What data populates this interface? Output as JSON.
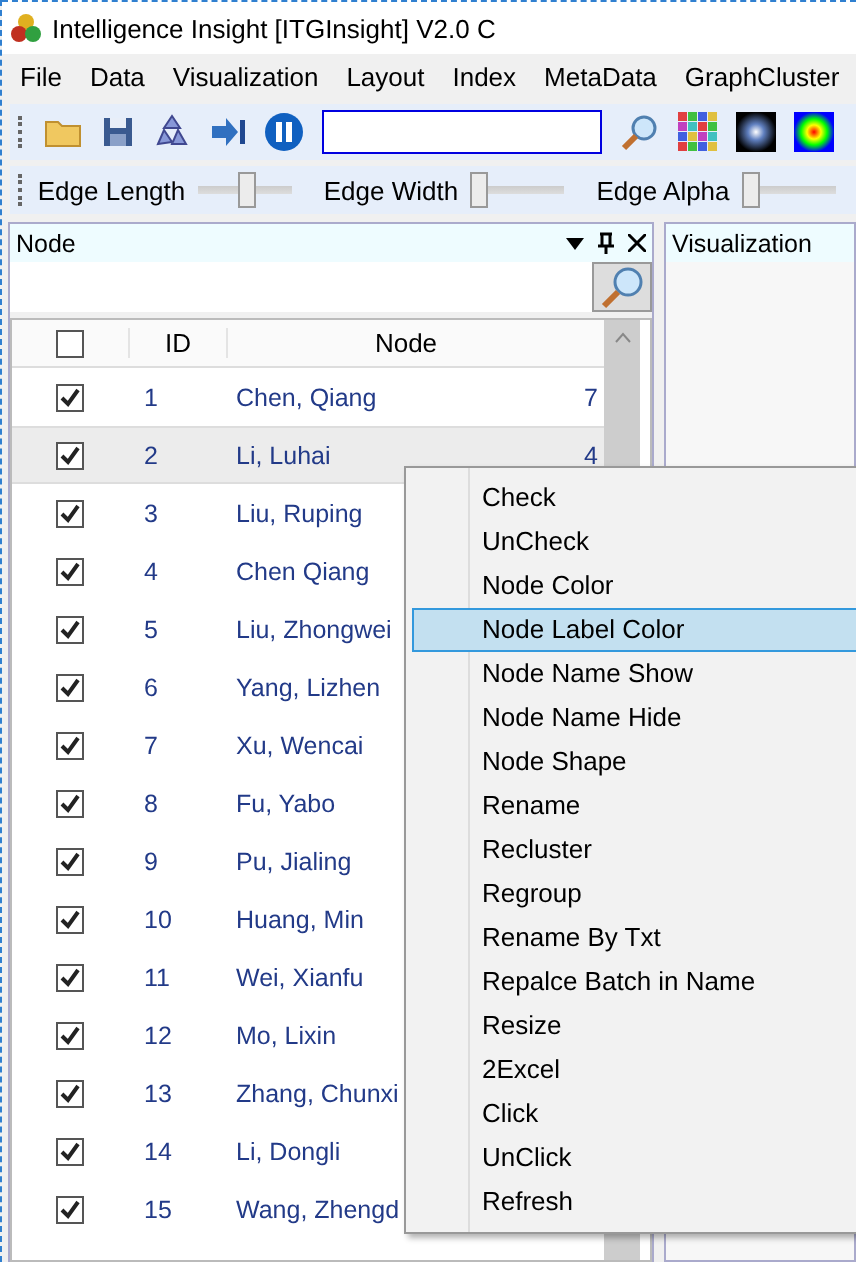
{
  "window": {
    "title": "Intelligence Insight [ITGInsight] V2.0 C"
  },
  "menu": [
    "File",
    "Data",
    "Visualization",
    "Layout",
    "Index",
    "MetaData",
    "GraphCluster"
  ],
  "sliders": [
    {
      "label": "Edge Length",
      "level": 0.5
    },
    {
      "label": "Edge Width",
      "level": 0
    },
    {
      "label": "Edge Alpha",
      "level": 0
    }
  ],
  "node_panel": {
    "title": "Node",
    "columns": [
      "ID",
      "Node"
    ],
    "header_checked": false,
    "rows": [
      {
        "id": "1",
        "name": "Chen, Qiang",
        "column_3": "7",
        "checked": true,
        "selected": false
      },
      {
        "id": "2",
        "name": "Li, Luhai",
        "column_3": "4",
        "checked": true,
        "selected": true
      },
      {
        "id": "3",
        "name": "Liu, Ruping",
        "checked": true,
        "selected": false
      },
      {
        "id": "4",
        "name": "Chen Qiang",
        "checked": true,
        "selected": false
      },
      {
        "id": "5",
        "name": "Liu, Zhongwei",
        "checked": true,
        "selected": false
      },
      {
        "id": "6",
        "name": "Yang, Lizhen",
        "checked": true,
        "selected": false
      },
      {
        "id": "7",
        "name": "Xu, Wencai",
        "checked": true,
        "selected": false
      },
      {
        "id": "8",
        "name": "Fu, Yabo",
        "checked": true,
        "selected": false
      },
      {
        "id": "9",
        "name": "Pu, Jialing",
        "checked": true,
        "selected": false
      },
      {
        "id": "10",
        "name": "Huang, Min",
        "checked": true,
        "selected": false
      },
      {
        "id": "11",
        "name": "Wei, Xianfu",
        "checked": true,
        "selected": false
      },
      {
        "id": "12",
        "name": "Mo, Lixin",
        "checked": true,
        "selected": false
      },
      {
        "id": "13",
        "name": "Zhang, Chunxi",
        "checked": true,
        "selected": false
      },
      {
        "id": "14",
        "name": "Li, Dongli",
        "checked": true,
        "selected": false
      },
      {
        "id": "15",
        "name": "Wang, Zhengd",
        "checked": true,
        "selected": false
      }
    ]
  },
  "visualization_panel": {
    "title": "Visualization"
  },
  "context_menu": [
    {
      "label": "Check",
      "selected": false
    },
    {
      "label": "UnCheck",
      "selected": false
    },
    {
      "label": "Node Color",
      "selected": false
    },
    {
      "label": "Node Label Color",
      "selected": true
    },
    {
      "label": "Node Name Show",
      "selected": false
    },
    {
      "label": "Node Name Hide",
      "selected": false
    },
    {
      "label": "Node Shape",
      "selected": false
    },
    {
      "label": "Rename",
      "selected": false
    },
    {
      "label": "Recluster",
      "selected": false
    },
    {
      "label": "Regroup",
      "selected": false
    },
    {
      "label": "Rename By Txt",
      "selected": false
    },
    {
      "label": "Repalce Batch in Name",
      "selected": false
    },
    {
      "label": "Resize",
      "selected": false
    },
    {
      "label": "2Excel",
      "selected": false
    },
    {
      "label": "Click",
      "selected": false
    },
    {
      "label": "UnClick",
      "selected": false
    },
    {
      "label": "Refresh",
      "selected": false
    }
  ]
}
